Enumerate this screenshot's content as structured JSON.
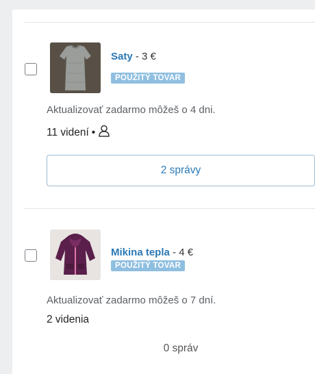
{
  "listings": [
    {
      "title": "Saty",
      "price": " - 3 €",
      "badge": "POUŽITÝ TOVAR",
      "note": "Aktualizovať zadarmo môžeš o 4 dni.",
      "views": "11 videní",
      "views_separator": "•",
      "views_icon": "user-icon",
      "messages": "2 správy"
    },
    {
      "title": "Mikina tepla",
      "price": " - 4 €",
      "badge": "POUŽITÝ TOVAR",
      "note": "Aktualizovať zadarmo môžeš o 7 dní.",
      "views": "2 videnia",
      "messages": "0 správ"
    }
  ],
  "colors": {
    "accent": "#2a79b6",
    "badge_bg": "#8fbfe0",
    "page_bg": "#eceef0"
  }
}
